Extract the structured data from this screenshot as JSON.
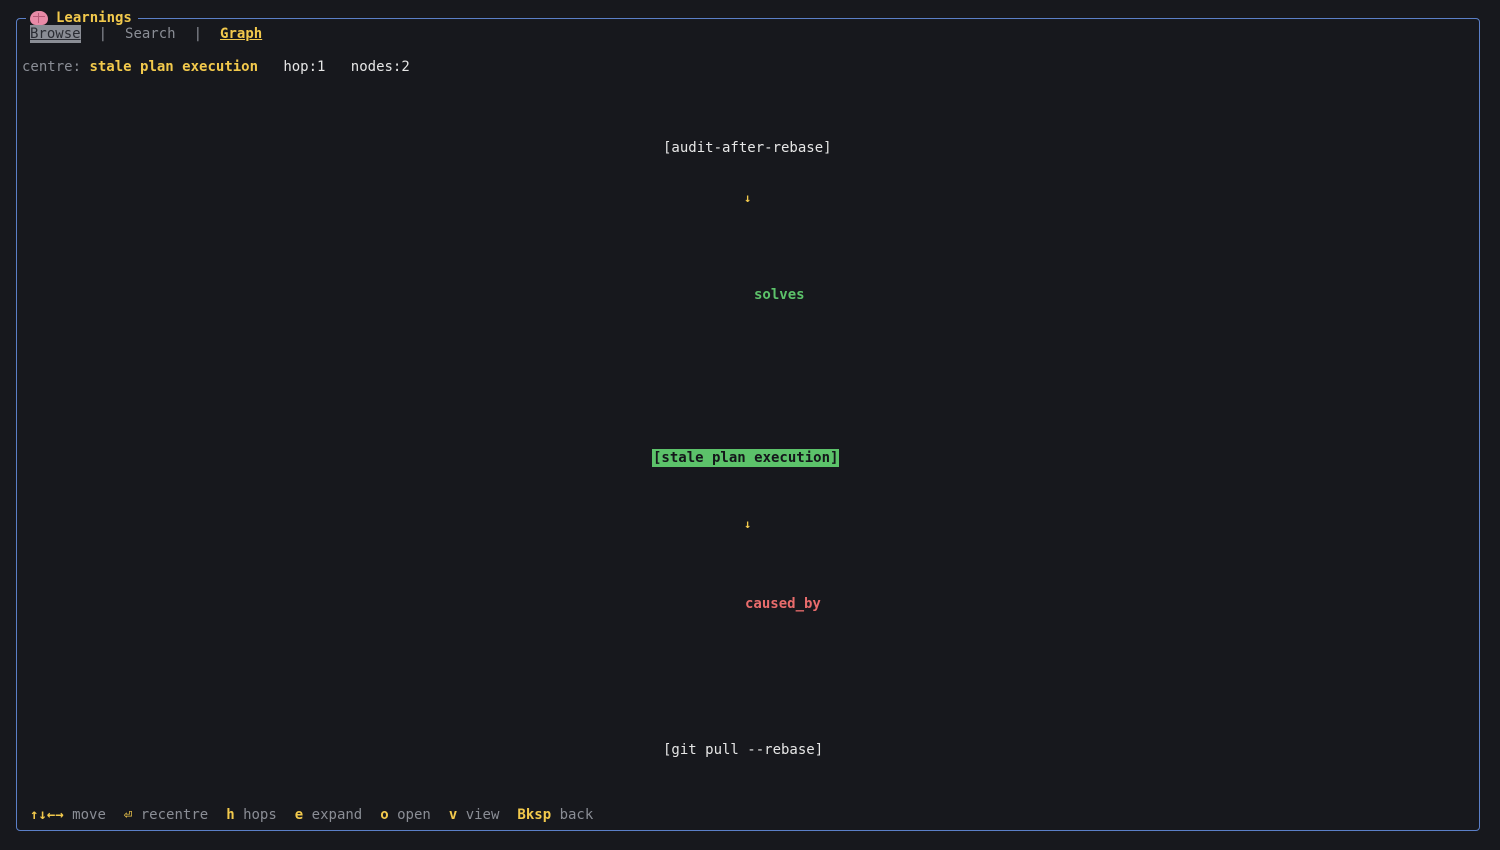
{
  "app": {
    "title": "Learnings",
    "icon": "brain-icon"
  },
  "tabs": {
    "browse": "Browse",
    "sep1": "|",
    "search": "Search",
    "sep2": "|",
    "graph": "Graph",
    "active": "Graph"
  },
  "status": {
    "centre_label": "centre:",
    "centre_value": "stale plan execution",
    "hop": "hop:1",
    "nodes": "nodes:2"
  },
  "graph": {
    "top_node": "[audit-after-rebase]",
    "arrow1": "↓",
    "edge1": "solves",
    "centre_node": "[stale plan execution]",
    "arrow2": "↓",
    "edge2": "caused_by",
    "bottom_node": "[git pull --rebase]"
  },
  "footer": {
    "move_key": "↑↓←→",
    "move_label": "move",
    "recentre_key": "⏎",
    "recentre_label": "recentre",
    "hops_key": "h",
    "hops_label": "hops",
    "expand_key": "e",
    "expand_label": "expand",
    "open_key": "o",
    "open_label": "open",
    "view_key": "v",
    "view_label": "view",
    "back_key": "Bksp",
    "back_label": "back"
  },
  "colors": {
    "background": "#17181d",
    "border": "#5b7fc7",
    "accent": "#f2c94c",
    "solves": "#5cc26a",
    "caused_by": "#e86c6c",
    "centre_highlight": "#5cc26a"
  }
}
